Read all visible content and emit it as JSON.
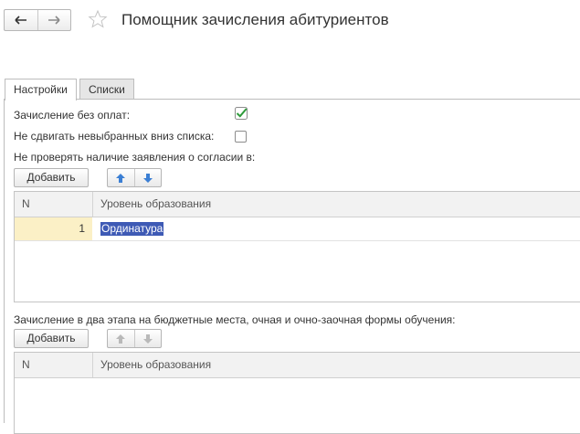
{
  "window": {
    "title": "Помощник зачисления абитуриентов"
  },
  "nav": {
    "back_icon": "arrow-left-icon",
    "forward_icon": "arrow-right-icon",
    "favorite_icon": "star-icon"
  },
  "tabs": [
    {
      "label": "Настройки",
      "active": true
    },
    {
      "label": "Списки",
      "active": false
    }
  ],
  "settings": {
    "enroll_without_payment": {
      "label": "Зачисление без оплат:",
      "checked": true
    },
    "no_move_unselected": {
      "label": "Не сдвигать невыбранных вниз списка:",
      "checked": false
    },
    "no_check_consent_label": "Не проверять наличие заявления о согласии в:"
  },
  "table1": {
    "add_button": "Добавить",
    "columns": [
      "N",
      "Уровень образования"
    ],
    "rows": [
      {
        "n": "1",
        "level": "Ординатура"
      }
    ]
  },
  "two_stage_label": "Зачисление в два этапа на бюджетные места, очная и очно-заочная формы обучения:",
  "table2": {
    "add_button": "Добавить",
    "columns": [
      "N",
      "Уровень образования"
    ],
    "rows": []
  },
  "colors": {
    "checkmark": "#2e9b3a",
    "arrow_active": "#3b7fd4",
    "arrow_disabled": "#b9b9b9",
    "selection": "#3e5ab5",
    "n_cell_bg": "#fbf0c6"
  }
}
